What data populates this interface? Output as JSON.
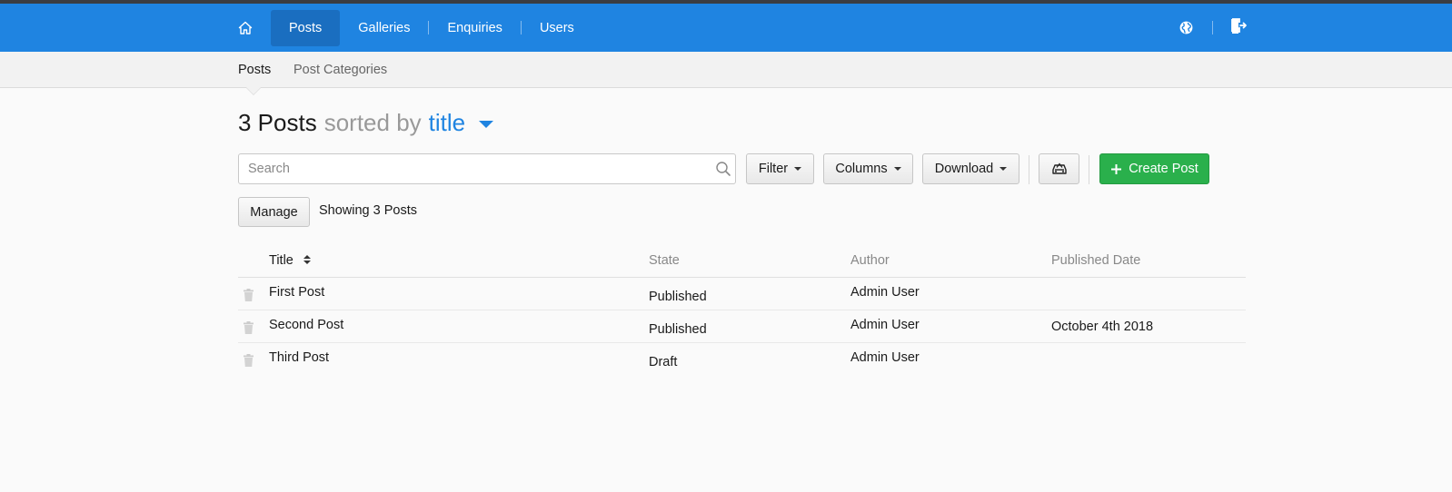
{
  "nav": {
    "home_icon": "home-icon",
    "items": [
      {
        "label": "Posts",
        "active": true
      },
      {
        "label": "Galleries",
        "active": false
      },
      {
        "label": "Enquiries",
        "active": false
      },
      {
        "label": "Users",
        "active": false
      }
    ],
    "right_icons": [
      "globe-icon",
      "sign-out-icon"
    ]
  },
  "subnav": {
    "items": [
      {
        "label": "Posts",
        "active": true
      },
      {
        "label": "Post Categories",
        "active": false
      }
    ]
  },
  "heading": {
    "count": "3 Posts",
    "sorted_by_text": "sorted by",
    "sort_field": "title"
  },
  "search": {
    "placeholder": "Search",
    "value": ""
  },
  "toolbar": {
    "filter_label": "Filter",
    "columns_label": "Columns",
    "download_label": "Download",
    "toggle_icon": "car-icon",
    "create_label": "Create Post"
  },
  "manage": {
    "manage_label": "Manage",
    "showing_text": "Showing 3 Posts"
  },
  "table": {
    "columns": [
      "Title",
      "State",
      "Author",
      "Published Date"
    ],
    "rows": [
      {
        "title": "First Post",
        "state": "Published",
        "author": "Admin User",
        "published_date": ""
      },
      {
        "title": "Second Post",
        "state": "Published",
        "author": "Admin User",
        "published_date": "October 4th 2018"
      },
      {
        "title": "Third Post",
        "state": "Draft",
        "author": "Admin User",
        "published_date": ""
      }
    ]
  },
  "colors": {
    "navbar": "#1f84e1",
    "navbar_active": "#1a6ec0",
    "accent": "#1f84e1",
    "create_button": "#2ab04c"
  }
}
